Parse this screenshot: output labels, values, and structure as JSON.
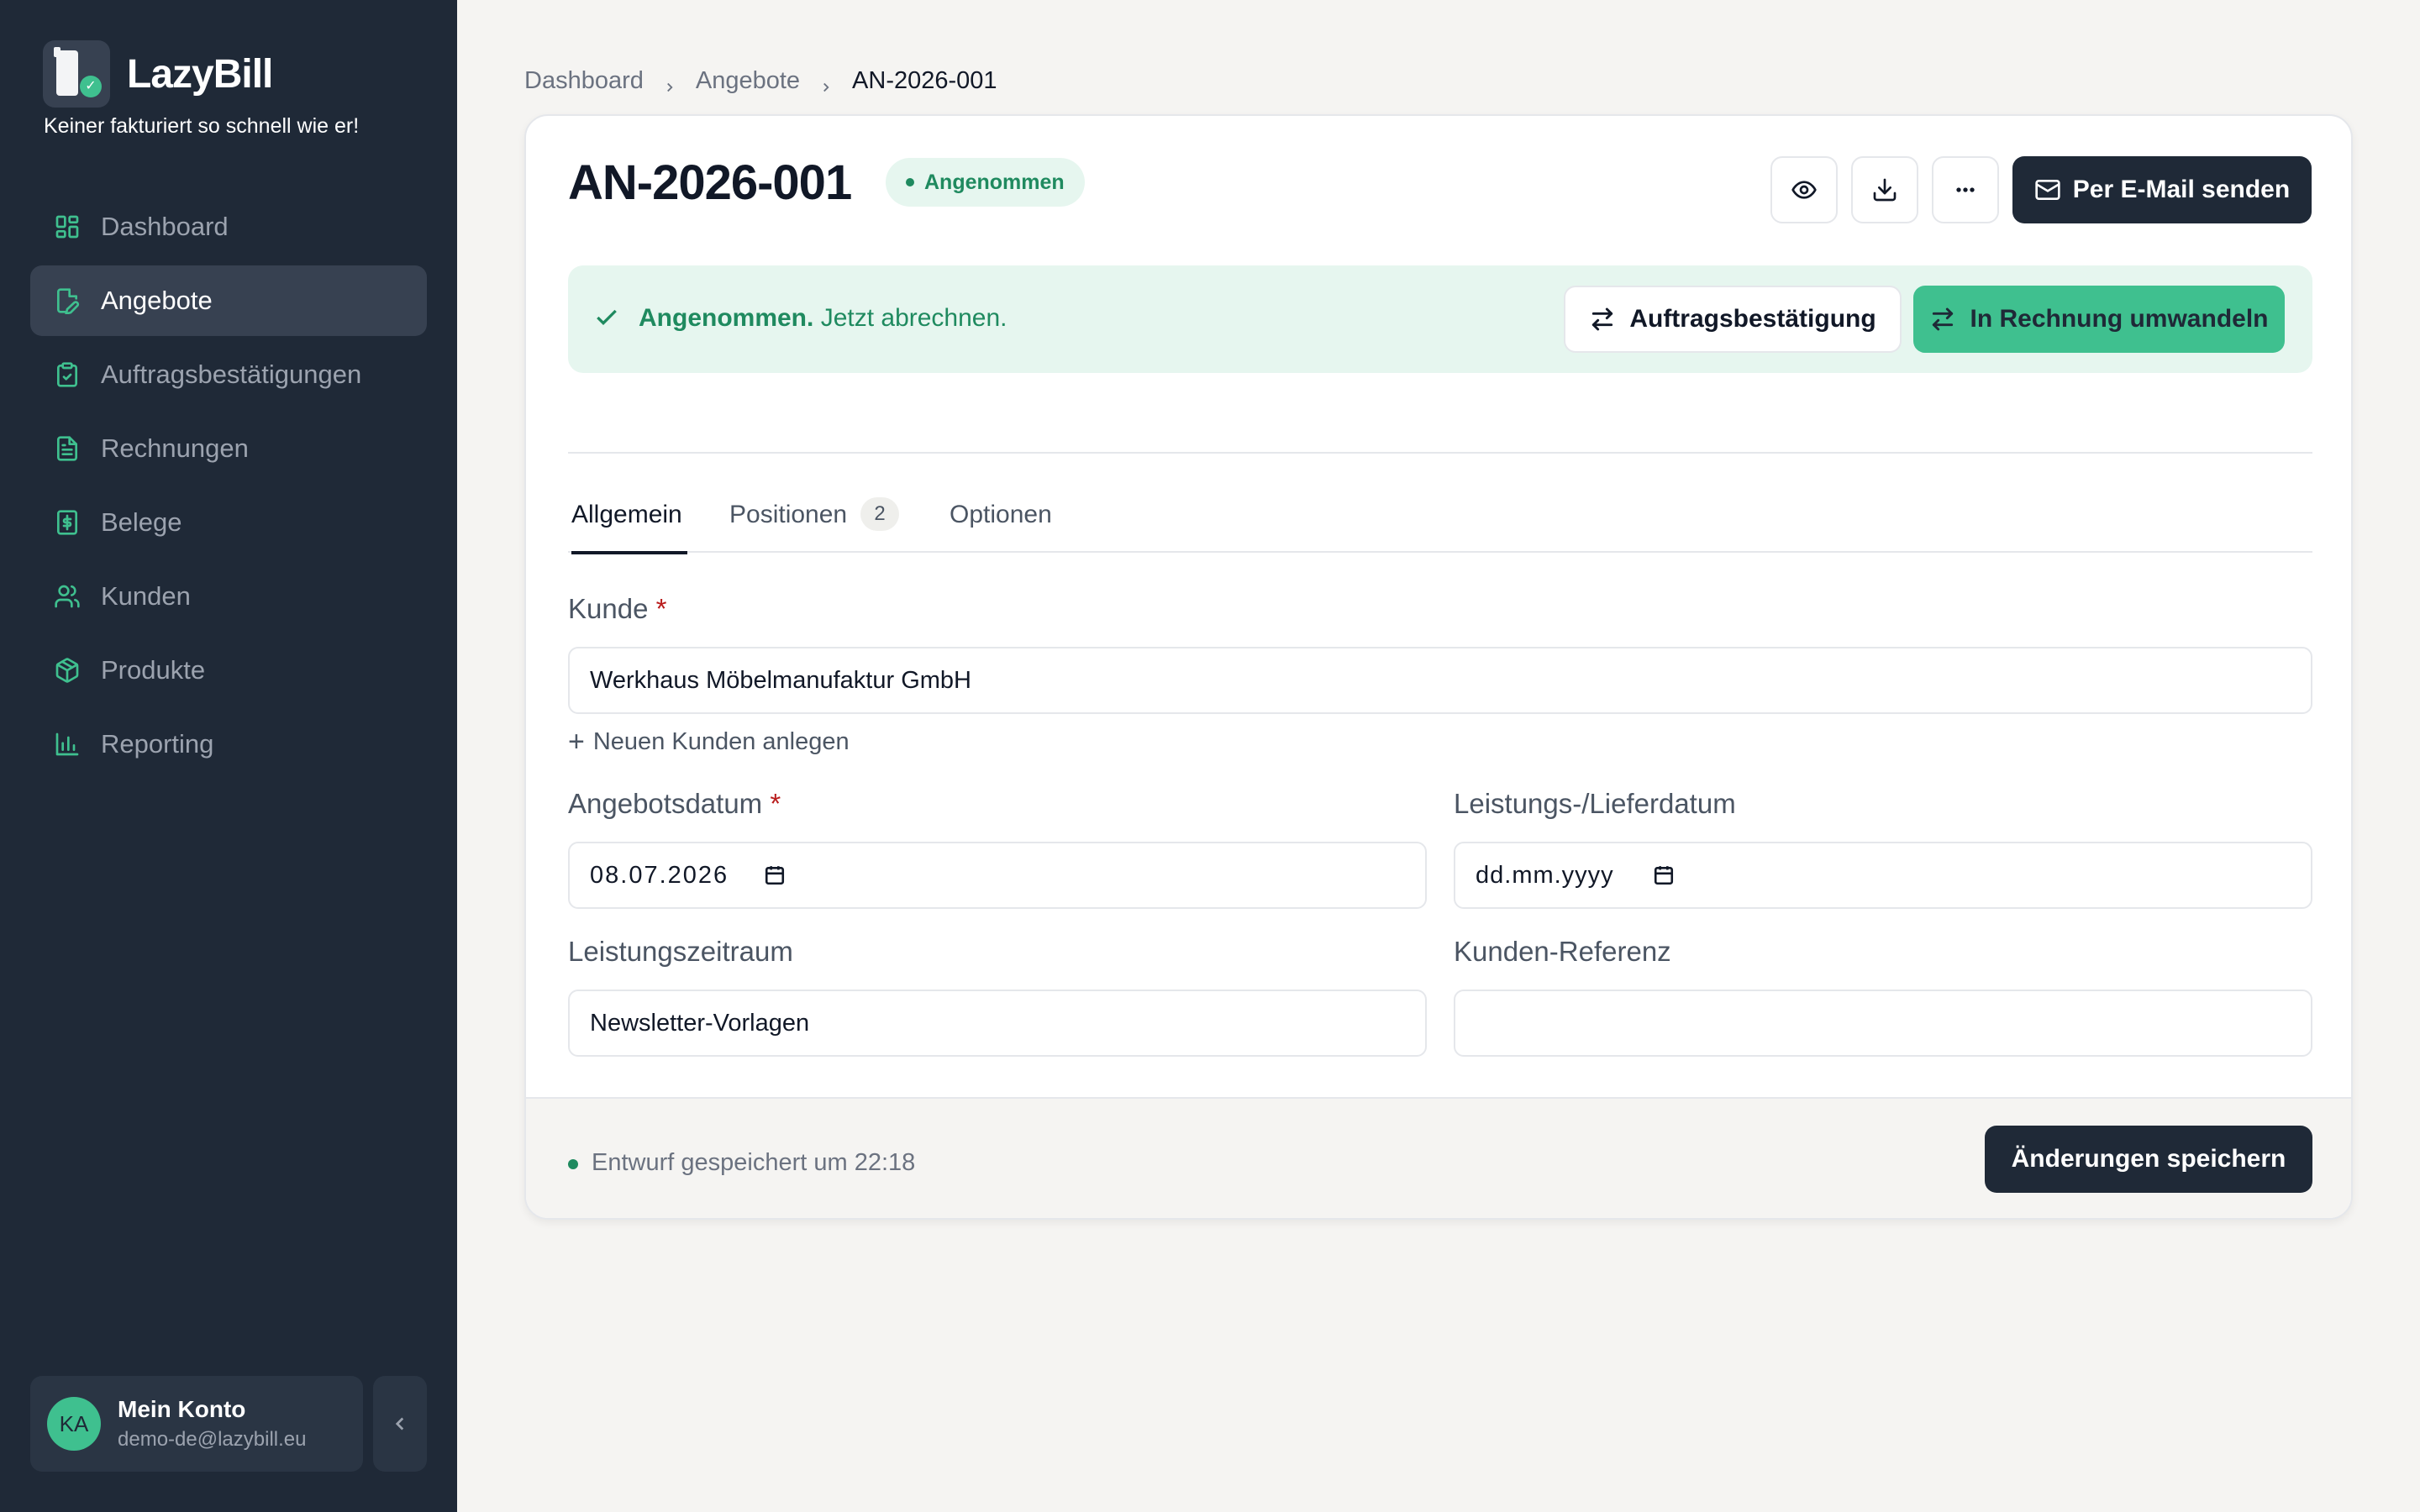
{
  "brand": {
    "name": "LazyBill",
    "tagline": "Keiner fakturiert so schnell wie er!"
  },
  "sidebar": {
    "items": [
      {
        "label": "Dashboard",
        "icon": "dashboard-icon"
      },
      {
        "label": "Angebote",
        "icon": "file-edit-icon",
        "active": true
      },
      {
        "label": "Auftragsbestätigungen",
        "icon": "clipboard-check-icon"
      },
      {
        "label": "Rechnungen",
        "icon": "file-text-icon"
      },
      {
        "label": "Belege",
        "icon": "receipt-icon"
      },
      {
        "label": "Kunden",
        "icon": "users-icon"
      },
      {
        "label": "Produkte",
        "icon": "package-icon"
      },
      {
        "label": "Reporting",
        "icon": "bar-chart-icon"
      }
    ]
  },
  "account": {
    "initials": "KA",
    "name": "Mein Konto",
    "email": "demo-de@lazybill.eu"
  },
  "breadcrumb": {
    "items": [
      "Dashboard",
      "Angebote",
      "AN-2026-001"
    ]
  },
  "document": {
    "title": "AN-2026-001",
    "status": "Angenommen",
    "email_button": "Per E-Mail senden"
  },
  "banner": {
    "bold": "Angenommen.",
    "text": "Jetzt abrechnen.",
    "order_button": "Auftragsbestätigung",
    "invoice_button": "In Rechnung umwandeln"
  },
  "tabs": [
    {
      "label": "Allgemein",
      "active": true
    },
    {
      "label": "Positionen",
      "count": "2"
    },
    {
      "label": "Optionen"
    }
  ],
  "form": {
    "customer_label": "Kunde",
    "customer_value": "Werkhaus Möbelmanufaktur GmbH",
    "add_customer": "Neuen Kunden anlegen",
    "offer_date_label": "Angebotsdatum",
    "offer_date_value": "08.07.2026",
    "delivery_date_label": "Leistungs-/Lieferdatum",
    "delivery_date_placeholder": "dd.mm.yyyy",
    "period_label": "Leistungszeitraum",
    "period_value": "Newsletter-Vorlagen",
    "reference_label": "Kunden-Referenz",
    "reference_value": "",
    "required_marker": "*"
  },
  "footer": {
    "status": "Entwurf gespeichert um 22:18",
    "save_button": "Änderungen speichern"
  },
  "colors": {
    "sidebar": "#1f2937",
    "accent": "#3fc08f",
    "success_text": "#1f8a5f",
    "background": "#f5f4f2"
  }
}
